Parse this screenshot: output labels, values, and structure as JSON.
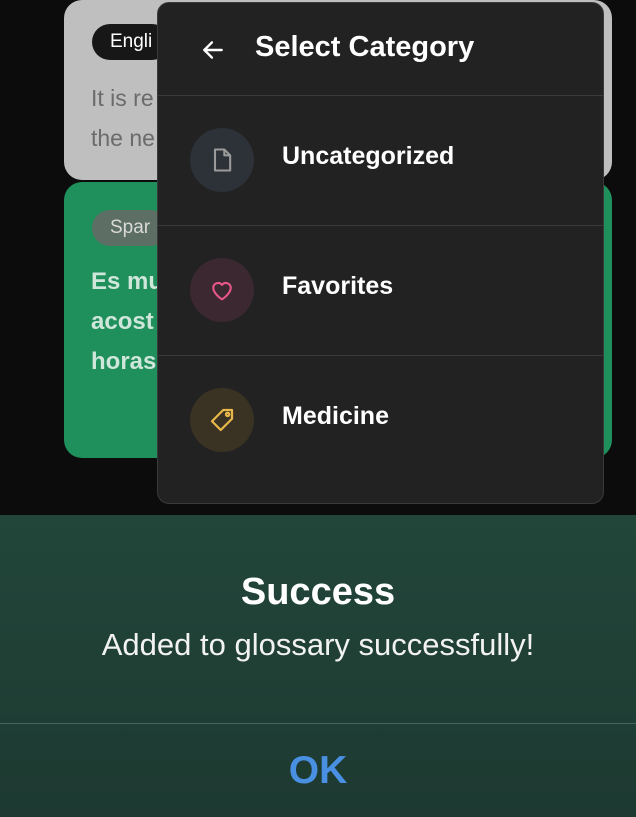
{
  "background_cards": [
    {
      "language": "Engli",
      "text_lines": [
        "It is re",
        "the ne"
      ]
    },
    {
      "language": "Spar",
      "text_lines": [
        "Es mu",
        "acost",
        "horas"
      ]
    }
  ],
  "category_menu": {
    "title": "Select Category",
    "back_icon": "arrow-left-icon",
    "items": [
      {
        "label": "Uncategorized",
        "icon": "document-icon",
        "icon_color": "#9a9a9a",
        "circle_color": "#2d3138"
      },
      {
        "label": "Favorites",
        "icon": "heart-icon",
        "icon_color": "#e8558a",
        "circle_color": "#3b2830"
      },
      {
        "label": "Medicine",
        "icon": "tag-icon",
        "icon_color": "#e8b94a",
        "circle_color": "#3a3223"
      }
    ]
  },
  "dialog": {
    "title": "Success",
    "message": "Added to glossary successfully!",
    "ok_label": "OK",
    "ok_color": "#4a90e2"
  }
}
